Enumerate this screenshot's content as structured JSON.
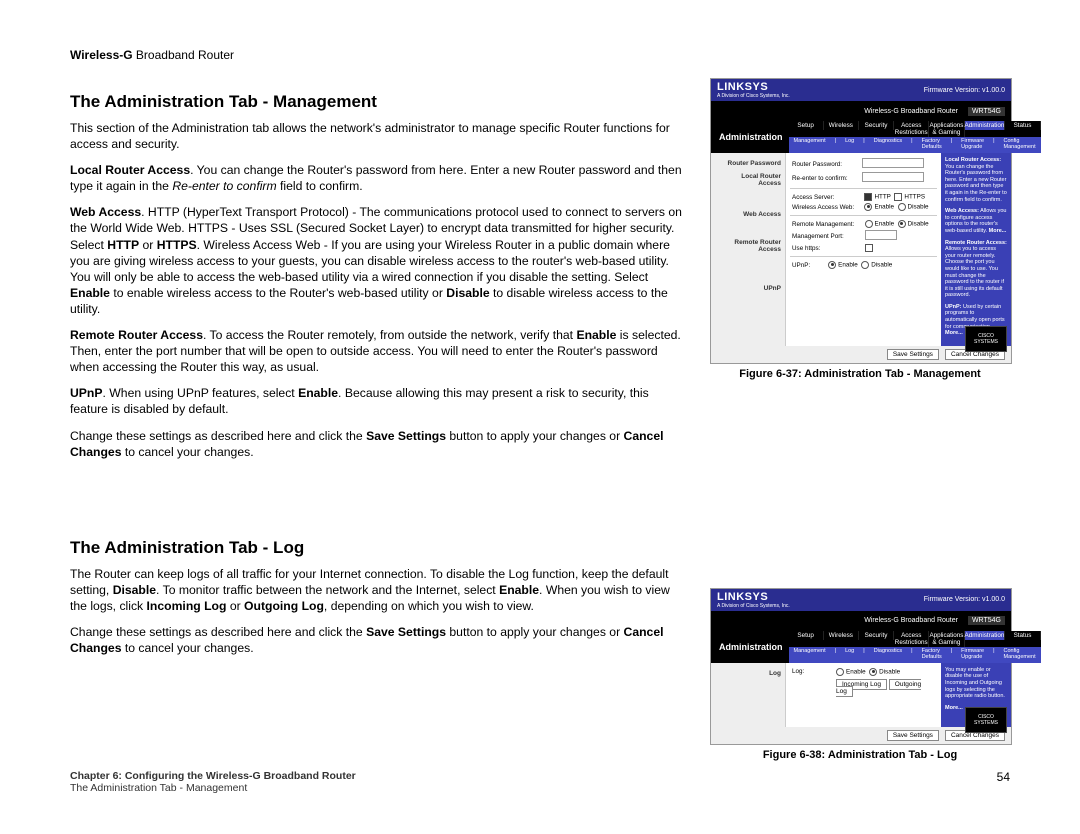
{
  "doc_header_bold": "Wireless-G",
  "doc_header_rest": " Broadband Router",
  "section1_title": "The Administration Tab - Management",
  "section1_p1": "This section of the Administration tab allows the network's administrator to manage specific Router functions for access and security.",
  "s1_local_bold": "Local Router Access",
  "s1_local_text_a": ". You can change the Router's password from here. Enter a new Router password and then type it again in the ",
  "s1_local_italic": "Re-enter to confirm",
  "s1_local_text_b": " field to confirm.",
  "s1_web_bold": "Web Access",
  "s1_web_text_a": ". HTTP (HyperText Transport Protocol) - The communications protocol used to connect to servers on the World Wide Web. HTTPS - Uses SSL (Secured Socket Layer) to encrypt data transmitted for higher security. Select ",
  "s1_web_http": "HTTP",
  "s1_web_or": " or ",
  "s1_web_https": "HTTPS",
  "s1_web_text_b": ". Wireless Access Web - If you are using your Wireless Router in a public domain where you are giving wireless access to your guests, you can disable wireless access to the router's web-based utility. You will only be able to access the web-based utility via a wired connection if you disable the setting. Select ",
  "s1_web_enable": "Enable",
  "s1_web_text_c": " to enable wireless access to the Router's web-based utility or ",
  "s1_web_disable": "Disable",
  "s1_web_text_d": " to disable wireless access to the utility.",
  "s1_remote_bold": "Remote Router Access",
  "s1_remote_text_a": ". To access the Router remotely, from outside the network, verify that ",
  "s1_remote_enable": "Enable",
  "s1_remote_text_b": " is selected. Then, enter the port number that will be open to outside access. You will need to enter the Router's password when accessing the Router this way, as usual.",
  "s1_upnp_bold": "UPnP",
  "s1_upnp_text_a": ". When using UPnP features, select ",
  "s1_upnp_enable": "Enable",
  "s1_upnp_text_b": ". Because allowing this may present a risk to security, this feature is disabled by default.",
  "save_text_a": "Change these settings as described here and click the ",
  "save_btn": "Save Settings",
  "save_text_b": " button to apply your changes or ",
  "cancel_btn": "Cancel Changes",
  "save_text_c": " to cancel your changes.",
  "section2_title": "The Administration Tab - Log",
  "s2_p1_a": "The Router can keep logs of all traffic for your Internet connection. To disable the Log function, keep the default setting, ",
  "s2_disable": "Disable",
  "s2_p1_b": ". To monitor traffic between the network and the Internet, select ",
  "s2_enable": "Enable",
  "s2_p1_c": ". When you wish to view the logs, click ",
  "s2_incoming": "Incoming Log",
  "s2_or": " or ",
  "s2_outgoing": "Outgoing Log",
  "s2_p1_d": ", depending on which you wish to view.",
  "fig1_caption": "Figure 6-37: Administration Tab - Management",
  "fig2_caption": "Figure 6-38: Administration Tab - Log",
  "footer_chapter_bold": "Chapter 6: Configuring the Wireless-G Broadband Router",
  "footer_sub": "The Administration Tab - Management",
  "page_number": "54",
  "router": {
    "brand": "LINKSYS",
    "brand_sub": "A Division of Cisco Systems, Inc.",
    "firmware": "Firmware Version: v1.00.0",
    "model_title": "Wireless-G Broadband Router",
    "model": "WRT54G",
    "nav_label": "Administration",
    "tabs": [
      "Setup",
      "Wireless",
      "Security",
      "Access Restrictions",
      "Applications & Gaming",
      "Administration",
      "Status"
    ],
    "subtabs": [
      "Management",
      "Log",
      "Diagnostics",
      "Factory Defaults",
      "Firmware Upgrade",
      "Config Management"
    ],
    "save": "Save Settings",
    "cancel": "Cancel Changes",
    "cisco": "CISCO SYSTEMS",
    "mgmt": {
      "left_labels": [
        "Router Password",
        "Local Router Access",
        "",
        "Web Access",
        "",
        "Remote Router Access",
        "",
        "",
        "UPnP"
      ],
      "rows": {
        "router_password": "Router Password:",
        "reenter": "Re-enter to confirm:",
        "access_server": "Access Server:",
        "http": "HTTP",
        "https": "HTTPS",
        "wireless_web": "Wireless Access Web:",
        "enable": "Enable",
        "disable": "Disable",
        "remote_mgmt": "Remote Management:",
        "mgmt_port": "Management Port:",
        "use_https": "Use https:",
        "upnp": "UPnP:"
      },
      "help": {
        "h1b": "Local Router Access:",
        "h1": " You can change the Router's password from here. Enter a new Router password and then type it again in the Re-enter to confirm field to confirm.",
        "h2b": "Web Access:",
        "h2": " Allows you to configure access options to the router's web-based utility.",
        "h3b": "Remote Router Access:",
        "h3": " Allows you to access your router remotely. Choose the port you would like to use. You must change the password to the router if it is still using its default password.",
        "h4b": "UPnP:",
        "h4": " Used by certain programs to automatically open ports for communication.",
        "more": "More..."
      }
    },
    "log": {
      "left_label": "Log",
      "row_label": "Log:",
      "enable": "Enable",
      "disable": "Disable",
      "incoming": "Incoming Log",
      "outgoing": "Outgoing Log",
      "help1": "You may enable or disable the use of Incoming and Outgoing logs by selecting the appropriate radio button.",
      "more": "More..."
    }
  }
}
